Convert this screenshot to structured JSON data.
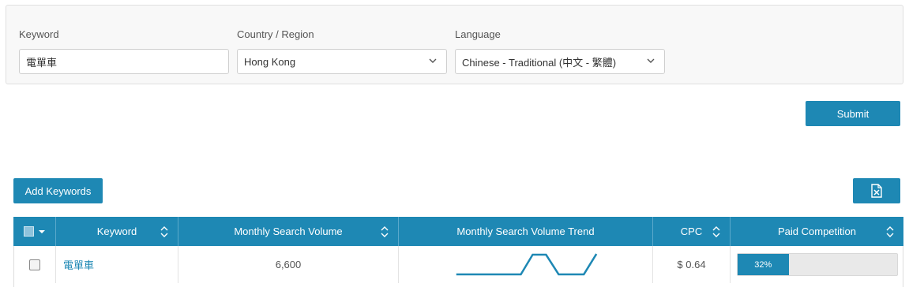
{
  "form": {
    "keyword": {
      "label": "Keyword",
      "value": "電單車"
    },
    "country": {
      "label": "Country / Region",
      "value": "Hong Kong"
    },
    "language": {
      "label": "Language",
      "value": "Chinese - Traditional (中文 - 繁體)"
    },
    "submit_label": "Submit"
  },
  "toolbar": {
    "add_keywords_label": "Add Keywords",
    "export_icon": "excel-export-icon"
  },
  "table": {
    "headers": {
      "keyword": "Keyword",
      "volume": "Monthly Search Volume",
      "trend": "Monthly Search Volume Trend",
      "cpc": "CPC",
      "competition": "Paid Competition"
    },
    "rows": [
      {
        "keyword": "電單車",
        "volume": "6,600",
        "cpc": "$ 0.64",
        "competition_label": "32%",
        "competition": 0.32
      }
    ]
  },
  "colors": {
    "accent": "#1e88b4"
  }
}
